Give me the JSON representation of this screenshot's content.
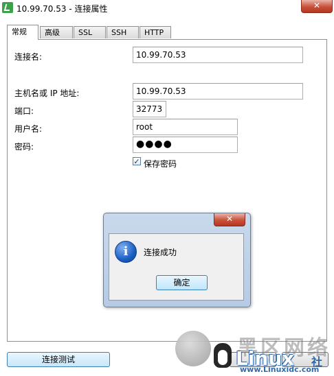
{
  "window": {
    "title": "10.99.70.53 - 连接属性",
    "close_glyph": "✕"
  },
  "tabs": [
    {
      "label": "常规",
      "active": true
    },
    {
      "label": "高级",
      "active": false
    },
    {
      "label": "SSL",
      "active": false
    },
    {
      "label": "SSH",
      "active": false
    },
    {
      "label": "HTTP",
      "active": false
    }
  ],
  "form": {
    "connection_name_label": "连接名:",
    "connection_name_value": "10.99.70.53",
    "host_label": "主机名或 IP 地址:",
    "host_value": "10.99.70.53",
    "port_label": "端口:",
    "port_value": "32773",
    "username_label": "用户名:",
    "username_value": "root",
    "password_label": "密码:",
    "password_value": "●●●●",
    "save_password_label": "保存密码",
    "save_password_checked": true,
    "checkmark": "✓"
  },
  "dialog": {
    "message": "连接成功",
    "ok_label": "确定",
    "icon": "info-icon",
    "icon_glyph": "i",
    "close_glyph": "✕"
  },
  "footer": {
    "test_button_label": "连接测试"
  },
  "watermark": {
    "title": "黑区网络",
    "brand": "Linux",
    "brand_suffix": "社",
    "url": "www.Linuxidc.com"
  }
}
